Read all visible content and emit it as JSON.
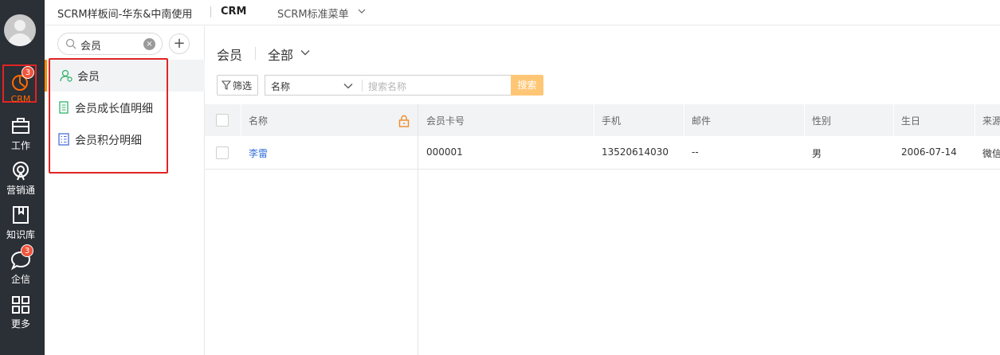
{
  "topbar": {
    "tenant": "SCRM样板间-华东&中南使用",
    "app": "CRM",
    "menu": "SCRM标准菜单"
  },
  "rail": {
    "items": [
      {
        "label": "CRM",
        "icon": "crm-chart-icon",
        "badge": "3",
        "active": true
      },
      {
        "label": "工作",
        "icon": "briefcase-icon"
      },
      {
        "label": "营销通",
        "icon": "broadcast-icon"
      },
      {
        "label": "知识库",
        "icon": "book-icon"
      },
      {
        "label": "企信",
        "icon": "chat-bubble-icon",
        "badge": "3"
      },
      {
        "label": "更多",
        "icon": "grid-icon"
      }
    ]
  },
  "sidebar": {
    "search_value": "会员",
    "clear_glyph": "×",
    "add_glyph": "+",
    "items": [
      {
        "label": "会员",
        "icon": "member-icon",
        "active": true
      },
      {
        "label": "会员成长值明细",
        "icon": "document-icon"
      },
      {
        "label": "会员积分明细",
        "icon": "list-table-icon"
      }
    ]
  },
  "main": {
    "object_name": "会员",
    "view_name": "全部",
    "filter_label": "筛选",
    "search_field": "名称",
    "search_placeholder": "搜索名称",
    "search_button": "搜索",
    "columns": [
      "名称",
      "会员卡号",
      "手机",
      "邮件",
      "性别",
      "生日",
      "来源"
    ],
    "rows": [
      {
        "name": "李雷",
        "card_no": "000001",
        "phone": "13520614030",
        "email": "--",
        "gender": "男",
        "birthday": "2006-07-14",
        "source": "微信"
      }
    ]
  },
  "colors": {
    "rail_bg": "#2b2f36",
    "accent_orange": "#ff8a00",
    "highlight_red": "#e02424",
    "link_blue": "#3370d6",
    "search_btn": "#ffc675"
  }
}
